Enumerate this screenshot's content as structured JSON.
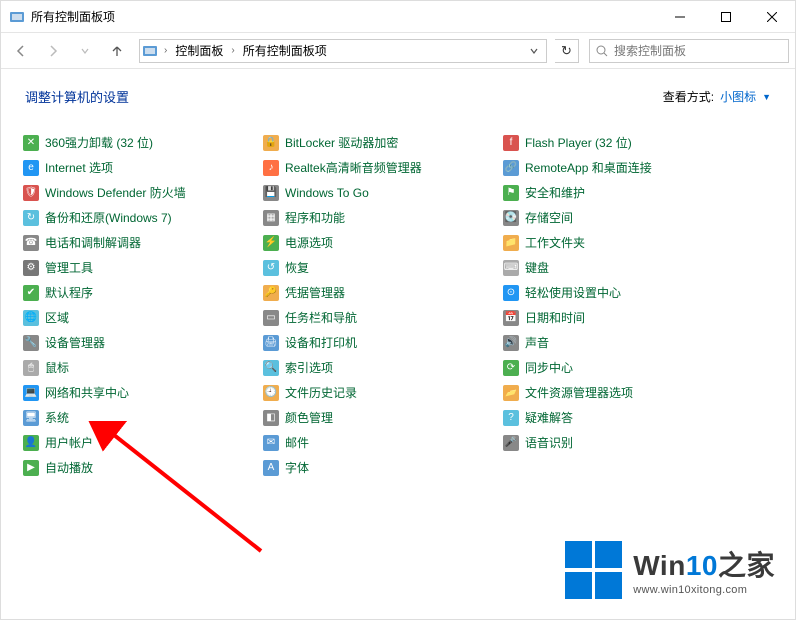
{
  "window": {
    "title": "所有控制面板项"
  },
  "breadcrumb": {
    "seg1": "控制面板",
    "seg2": "所有控制面板项"
  },
  "search": {
    "placeholder": "搜索控制面板"
  },
  "header": {
    "title": "调整计算机的设置",
    "view_label": "查看方式:",
    "view_value": "小图标"
  },
  "items": [
    {
      "label": "360强力卸载 (32 位)",
      "icon_bg": "#4CAF50",
      "glyph": "✕"
    },
    {
      "label": "Internet 选项",
      "icon_bg": "#2196F3",
      "glyph": "e"
    },
    {
      "label": "Windows Defender 防火墙",
      "icon_bg": "#d9534f",
      "glyph": "🛡"
    },
    {
      "label": "备份和还原(Windows 7)",
      "icon_bg": "#5bc0de",
      "glyph": "↻"
    },
    {
      "label": "电话和调制解调器",
      "icon_bg": "#888",
      "glyph": "☎"
    },
    {
      "label": "管理工具",
      "icon_bg": "#777",
      "glyph": "⚙"
    },
    {
      "label": "默认程序",
      "icon_bg": "#4CAF50",
      "glyph": "✔"
    },
    {
      "label": "区域",
      "icon_bg": "#5bc0de",
      "glyph": "🌐"
    },
    {
      "label": "设备管理器",
      "icon_bg": "#888",
      "glyph": "🔧"
    },
    {
      "label": "鼠标",
      "icon_bg": "#aaa",
      "glyph": "🖱"
    },
    {
      "label": "网络和共享中心",
      "icon_bg": "#2196F3",
      "glyph": "💻"
    },
    {
      "label": "系统",
      "icon_bg": "#5b9bd5",
      "glyph": "🖥"
    },
    {
      "label": "用户帐户",
      "icon_bg": "#4CAF50",
      "glyph": "👤"
    },
    {
      "label": "自动播放",
      "icon_bg": "#4CAF50",
      "glyph": "▶"
    },
    {
      "label": "BitLocker 驱动器加密",
      "icon_bg": "#f0ad4e",
      "glyph": "🔒"
    },
    {
      "label": "Realtek高清晰音频管理器",
      "icon_bg": "#ff7043",
      "glyph": "♪"
    },
    {
      "label": "Windows To Go",
      "icon_bg": "#888",
      "glyph": "💾"
    },
    {
      "label": "程序和功能",
      "icon_bg": "#888",
      "glyph": "▦"
    },
    {
      "label": "电源选项",
      "icon_bg": "#4CAF50",
      "glyph": "⚡"
    },
    {
      "label": "恢复",
      "icon_bg": "#5bc0de",
      "glyph": "↺"
    },
    {
      "label": "凭据管理器",
      "icon_bg": "#f0ad4e",
      "glyph": "🔑"
    },
    {
      "label": "任务栏和导航",
      "icon_bg": "#888",
      "glyph": "▭"
    },
    {
      "label": "设备和打印机",
      "icon_bg": "#5b9bd5",
      "glyph": "🖨"
    },
    {
      "label": "索引选项",
      "icon_bg": "#5bc0de",
      "glyph": "🔍"
    },
    {
      "label": "文件历史记录",
      "icon_bg": "#f0ad4e",
      "glyph": "🕘"
    },
    {
      "label": "颜色管理",
      "icon_bg": "#888",
      "glyph": "◧"
    },
    {
      "label": "邮件",
      "icon_bg": "#5b9bd5",
      "glyph": "✉"
    },
    {
      "label": "字体",
      "icon_bg": "#5b9bd5",
      "glyph": "A"
    },
    {
      "label": "Flash Player (32 位)",
      "icon_bg": "#d9534f",
      "glyph": "f"
    },
    {
      "label": "RemoteApp 和桌面连接",
      "icon_bg": "#5b9bd5",
      "glyph": "🔗"
    },
    {
      "label": "安全和维护",
      "icon_bg": "#4CAF50",
      "glyph": "⚑"
    },
    {
      "label": "存储空间",
      "icon_bg": "#888",
      "glyph": "💽"
    },
    {
      "label": "工作文件夹",
      "icon_bg": "#f0ad4e",
      "glyph": "📁"
    },
    {
      "label": "键盘",
      "icon_bg": "#aaa",
      "glyph": "⌨"
    },
    {
      "label": "轻松使用设置中心",
      "icon_bg": "#2196F3",
      "glyph": "⊙"
    },
    {
      "label": "日期和时间",
      "icon_bg": "#888",
      "glyph": "📅"
    },
    {
      "label": "声音",
      "icon_bg": "#888",
      "glyph": "🔊"
    },
    {
      "label": "同步中心",
      "icon_bg": "#4CAF50",
      "glyph": "⟳"
    },
    {
      "label": "文件资源管理器选项",
      "icon_bg": "#f0ad4e",
      "glyph": "📂"
    },
    {
      "label": "疑难解答",
      "icon_bg": "#5bc0de",
      "glyph": "?"
    },
    {
      "label": "语音识别",
      "icon_bg": "#888",
      "glyph": "🎤"
    }
  ],
  "watermark": {
    "brand_prefix": "Win",
    "brand_accent": "10",
    "brand_suffix": "之家",
    "url": "www.win10xitong.com"
  },
  "grid_rows": 14
}
